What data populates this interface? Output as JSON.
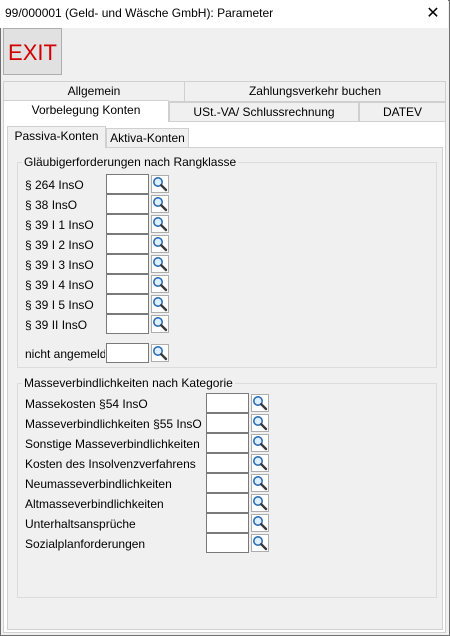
{
  "window": {
    "title": "99/000001 (Geld- und Wäsche GmbH): Parameter",
    "close_glyph": "✕"
  },
  "toolbar": {
    "exit_label": "EXIT"
  },
  "tabs": {
    "row_top": [
      "Allgemein",
      "Zahlungsverkehr buchen"
    ],
    "row_bottom": [
      "Vorbelegung Konten",
      "USt.-VA/ Schlussrechnung",
      "DATEV"
    ],
    "selected": "Vorbelegung Konten"
  },
  "subtabs": {
    "items": [
      "Passiva-Konten",
      "Aktiva-Konten"
    ],
    "selected": "Passiva-Konten"
  },
  "group_rang": {
    "title": "Gläubigerforderungen nach Rangklasse",
    "rows": [
      {
        "label": "§ 264 InsO",
        "value": ""
      },
      {
        "label": "§ 38 InsO",
        "value": ""
      },
      {
        "label": "§ 39 I 1 InsO",
        "value": ""
      },
      {
        "label": "§ 39 I 2 InsO",
        "value": ""
      },
      {
        "label": "§ 39 I 3 InsO",
        "value": ""
      },
      {
        "label": "§ 39 I 4 InsO",
        "value": ""
      },
      {
        "label": "§ 39 I 5 InsO",
        "value": ""
      },
      {
        "label": "§ 39 II InsO",
        "value": ""
      }
    ],
    "extra": {
      "label": "nicht angemeldet",
      "value": ""
    }
  },
  "group_masse": {
    "title": "Masseverbindlichkeiten nach Kategorie",
    "rows": [
      {
        "label": "Massekosten §54 InsO",
        "value": ""
      },
      {
        "label": "Masseverbindlichkeiten §55 InsO",
        "value": ""
      },
      {
        "label": "Sonstige Masseverbindlichkeiten",
        "value": ""
      },
      {
        "label": "Kosten des Insolvenzverfahrens",
        "value": ""
      },
      {
        "label": "Neumasseverbindlichkeiten",
        "value": ""
      },
      {
        "label": "Altmasseverbindlichkeiten",
        "value": ""
      },
      {
        "label": "Unterhaltsansprüche",
        "value": ""
      },
      {
        "label": "Sozialplanforderungen",
        "value": ""
      }
    ]
  },
  "icons": {
    "lookup": "magnifier-icon"
  },
  "colors": {
    "exit_text": "#d40000",
    "panel": "#f0f0f0",
    "field_border": "#7a7a7a"
  }
}
